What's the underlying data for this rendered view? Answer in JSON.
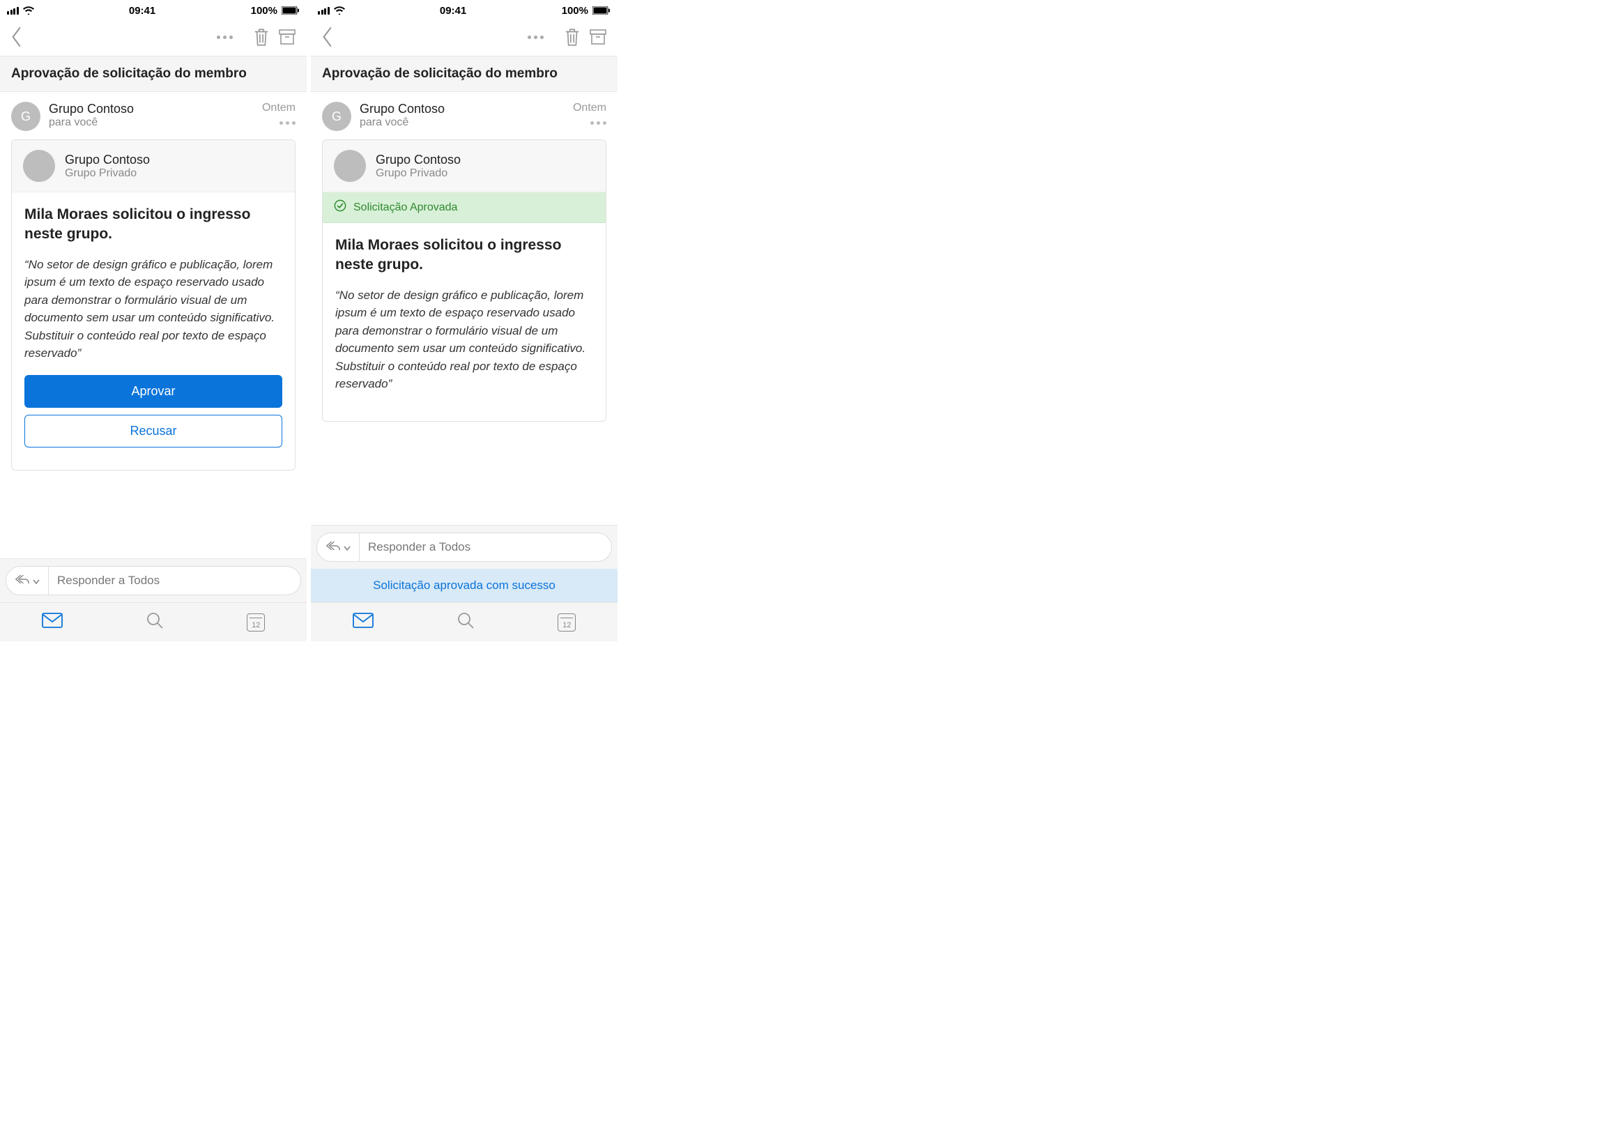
{
  "status": {
    "time": "09:41",
    "battery": "100%"
  },
  "toolbar": {
    "more": "more",
    "trash": "trash",
    "archive": "archive"
  },
  "subject": "Aprovação de solicitação do membro",
  "mail": {
    "sender": "Grupo Contoso",
    "avatar_letter": "G",
    "to": "para você",
    "time": "Ontem"
  },
  "card": {
    "group_name": "Grupo Contoso",
    "group_privacy": "Grupo Privado",
    "approved_label": "Solicitação Aprovada",
    "request_title": "Mila Moraes solicitou o ingresso neste grupo.",
    "request_quote": "“No setor de design gráfico e publicação, lorem ipsum é um texto de espaço reservado usado para demonstrar o formulário visual de um documento sem usar um conteúdo significativo. Substituir o conteúdo real por texto de espaço reservado”",
    "approve_btn": "Aprovar",
    "decline_btn": "Recusar"
  },
  "reply": {
    "label": "Responder a Todos"
  },
  "toast": {
    "message": "Solicitação aprovada com sucesso"
  },
  "tabs": {
    "calendar_day": "12"
  }
}
